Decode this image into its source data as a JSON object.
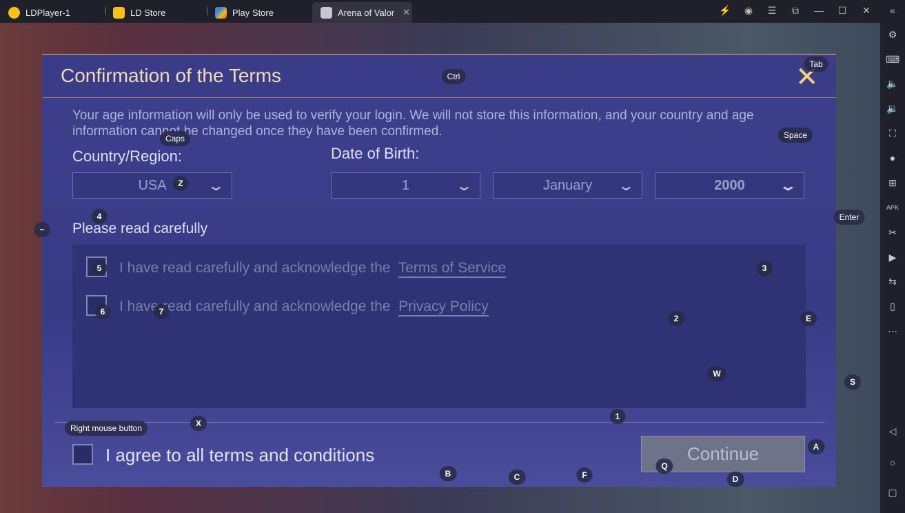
{
  "titlebar": {
    "tabs": [
      {
        "label": "LDPlayer-1",
        "icon": "ldplayer-icon"
      },
      {
        "label": "LD Store",
        "icon": "gamepad-icon"
      },
      {
        "label": "Play Store",
        "icon": "play-store-icon"
      },
      {
        "label": "Arena of Valor",
        "icon": "game-icon",
        "active": true
      }
    ],
    "close_tab": "✕",
    "controls": {
      "boost": "⚡",
      "account": "◉",
      "menu": "☰",
      "resize": "⧉",
      "minimize": "—",
      "maximize": "☐",
      "close": "✕",
      "collapse": "«"
    }
  },
  "sidebar": {
    "icons": [
      "settings",
      "keyboard",
      "volume-up",
      "volume-down",
      "fullscreen",
      "location",
      "multi-instance",
      "apk",
      "screenshot",
      "record",
      "sync",
      "shake",
      "more"
    ],
    "nav": {
      "back": "◁",
      "home": "○",
      "recent": "▢"
    }
  },
  "dialog": {
    "title": "Confirmation of the Terms",
    "close": "✕",
    "info": "Your age information will only be used to verify your login. We will not store this information, and your country and age information cannot be changed once they have been confirmed.",
    "country_label": "Country/Region:",
    "country_value": "USA",
    "dob_label": "Date of Birth:",
    "day": "1",
    "month": "January",
    "year": "2000",
    "read_label": "Please read carefully",
    "terms_prefix": "I have read carefully and acknowledge the",
    "terms_link": "Terms of Service",
    "privacy_prefix": "I have read carefully and acknowledge the",
    "privacy_link": "Privacy Policy",
    "agree_all": "I agree to all terms and conditions",
    "continue": "Continue"
  },
  "keymap": {
    "ctrl": "Ctrl",
    "tab": "Tab",
    "caps": "Caps",
    "space": "Space",
    "z": "Z",
    "four": "4",
    "tilde": "~",
    "enter": "Enter",
    "five": "5",
    "three": "3",
    "six": "6",
    "seven": "7",
    "two": "2",
    "e": "E",
    "w": "W",
    "s": "S",
    "x": "X",
    "one": "1",
    "rmb": "Right mouse button",
    "a": "A",
    "q": "Q",
    "b": "B",
    "c": "C",
    "f": "F",
    "d": "D"
  }
}
